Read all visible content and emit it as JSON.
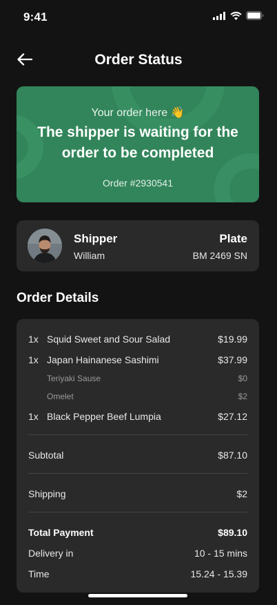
{
  "status_bar": {
    "time": "9:41"
  },
  "header": {
    "title": "Order Status"
  },
  "banner": {
    "subtitle": "Your order here 👋",
    "message": "The shipper is waiting for the order to be completed",
    "order_number": "Order #2930541"
  },
  "shipper": {
    "label": "Shipper",
    "name": "William",
    "plate_label": "Plate",
    "plate_value": "BM 2469 SN"
  },
  "order_details": {
    "title": "Order Details",
    "items": [
      {
        "qty": "1x",
        "name": "Squid Sweet and Sour Salad",
        "price": "$19.99"
      },
      {
        "qty": "1x",
        "name": "Japan Hainanese Sashimi",
        "price": "$37.99"
      },
      {
        "qty": "1x",
        "name": "Black Pepper Beef Lumpia",
        "price": "$27.12"
      }
    ],
    "addons": [
      {
        "name": "Teriyaki Sause",
        "price": "$0"
      },
      {
        "name": "Omelet",
        "price": "$2"
      }
    ],
    "subtotal_label": "Subtotal",
    "subtotal_value": "$87.10",
    "shipping_label": "Shipping",
    "shipping_value": "$2",
    "total_label": "Total Payment",
    "total_value": "$89.10",
    "delivery_label": "Delivery in",
    "delivery_value": "10 - 15 mins",
    "time_label": "Time",
    "time_value": "15.24 - 15.39"
  },
  "colors": {
    "background": "#131313",
    "card": "#2a2a2a",
    "banner": "#32855a"
  }
}
